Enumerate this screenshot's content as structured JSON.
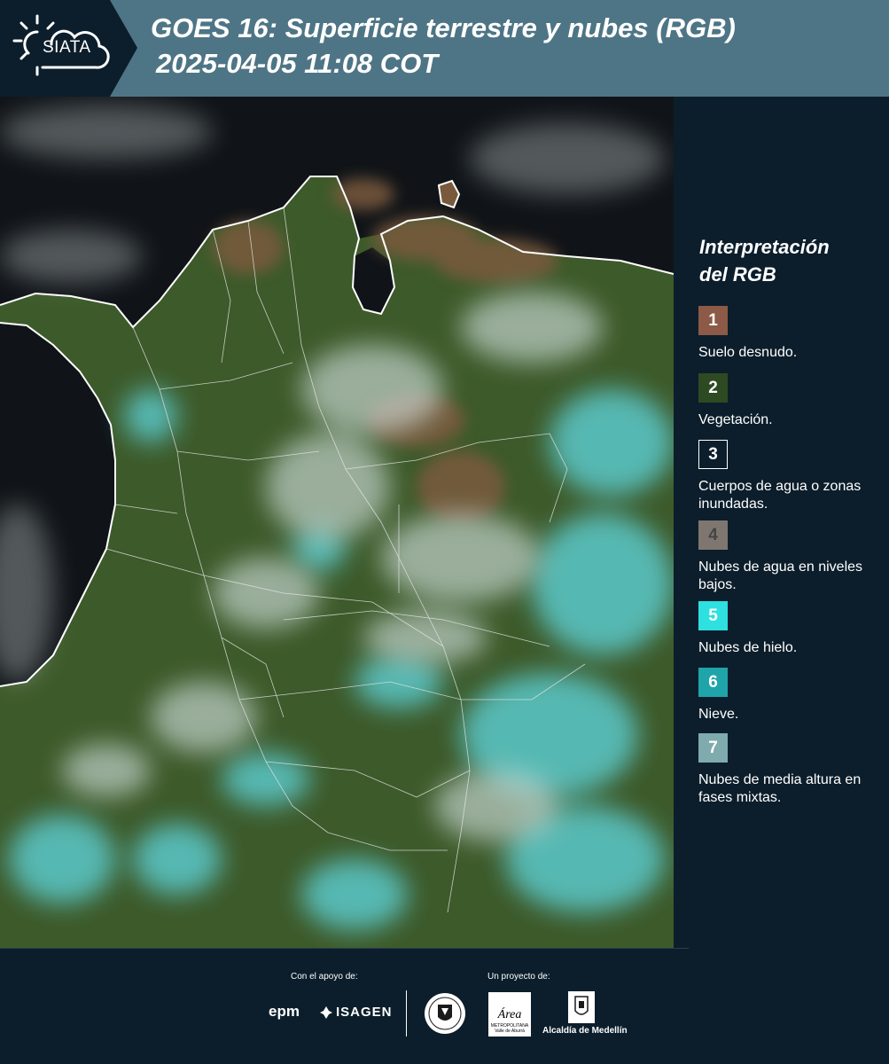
{
  "header": {
    "logo_text": "SIATA",
    "title_line1": "GOES 16: Superficie terrestre y nubes (RGB)",
    "title_line2": "2025-04-05 11:08 COT"
  },
  "legend": {
    "title_line1": "Interpretación",
    "title_line2": "del RGB",
    "items": [
      {
        "number": "1",
        "label": "Suelo desnudo.",
        "color": "#8c5a46"
      },
      {
        "number": "2",
        "label": "Vegetación.",
        "color": "#2d4a22"
      },
      {
        "number": "3",
        "label": "Cuerpos de agua o zonas inundadas.",
        "color": "#0c1e2b"
      },
      {
        "number": "4",
        "label": "Nubes de agua en niveles bajos.",
        "color": "#7f776f"
      },
      {
        "number": "5",
        "label": "Nubes de hielo.",
        "color": "#2ee0e0"
      },
      {
        "number": "6",
        "label": "Nieve.",
        "color": "#1fa4aa"
      },
      {
        "number": "7",
        "label": "Nubes de media altura en fases mixtas.",
        "color": "#7faaae"
      }
    ]
  },
  "footer": {
    "support_label": "Con el apoyo de:",
    "project_label": "Un proyecto de:",
    "sponsors": [
      "epm",
      "ISAGEN"
    ],
    "area_logo_text": "Área",
    "area_logo_sub": "METROPOLITANA Valle de Aburrá",
    "alcaldia": "Alcaldía de Medellín"
  },
  "colors": {
    "header_bg": "#4e7585",
    "panel_bg": "#0c1e2b",
    "ocean": "#101418",
    "vegetation": "#3d5a2a",
    "ice_cloud": "#5fd8e0",
    "bare_soil": "#7a5a3c"
  }
}
